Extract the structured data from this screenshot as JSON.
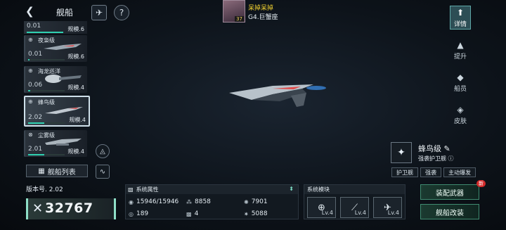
{
  "header": {
    "title": "舰船",
    "back_icon": "back-arrow-icon",
    "btn1_icon": "rocket-icon",
    "btn2_icon": "help-icon"
  },
  "player": {
    "name": "呆掉呆掉",
    "guild": "G4.巨蟹座",
    "level": "37"
  },
  "ship_list": {
    "first_card": {
      "pct": "0.01",
      "scale": "规模.6"
    },
    "cards": [
      {
        "name": "夜枭级",
        "pct": "0.01",
        "scale": "规模.6",
        "fill": 0.01
      },
      {
        "name": "海龙巡洋",
        "pct": "0.06",
        "scale": "规模.4",
        "fill": 0.06
      },
      {
        "name": "蜂鸟级",
        "pct": "2.02",
        "scale": "规模.4",
        "fill": 0.45
      },
      {
        "name": "尘雾级",
        "pct": "2.01",
        "scale": "规模.4",
        "fill": 0.45
      }
    ],
    "list_button": "舰船列表"
  },
  "version_label": "版本号. 2.02",
  "power": "32767",
  "right_tabs": [
    {
      "label": "详情",
      "icon": "ship-detail-icon"
    },
    {
      "label": "提升",
      "icon": "upgrade-icon"
    },
    {
      "label": "船员",
      "icon": "crew-icon"
    },
    {
      "label": "皮肤",
      "icon": "skin-icon"
    }
  ],
  "ship_info": {
    "name": "蜂鸟级",
    "type": "强袭护卫舰",
    "tags": [
      "护卫舰",
      "强袭",
      "主动爆发"
    ]
  },
  "attributes": {
    "title": "系统属性",
    "values": {
      "hp": "15946/15946",
      "a2": "8858",
      "a3": "7901",
      "a4": "189",
      "a5": "4",
      "a6": "5088"
    }
  },
  "modules": {
    "title": "系统模块",
    "items": [
      {
        "lv": "Lv.4"
      },
      {
        "lv": "Lv.4"
      },
      {
        "lv": "Lv.4"
      }
    ]
  },
  "actions": {
    "equip": "装配武器",
    "refit": "舰船改装",
    "new_badge": "新"
  },
  "colors": {
    "accent": "#2fd0b0",
    "active_tab": "#2d4e55",
    "player_name": "#f0d030"
  }
}
